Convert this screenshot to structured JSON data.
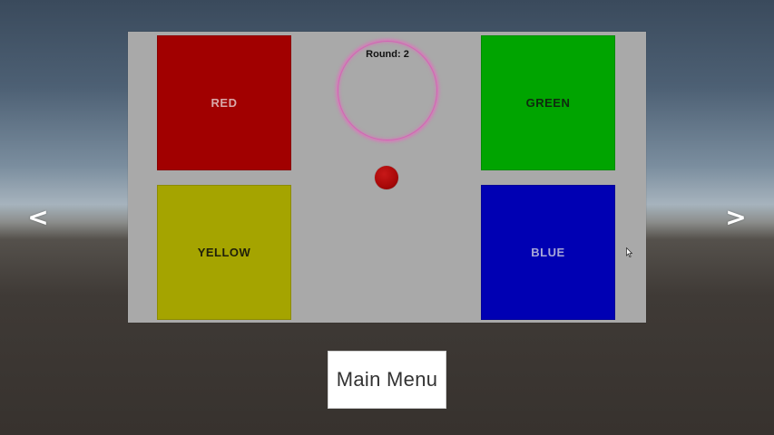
{
  "navigation": {
    "prev_label": "<",
    "next_label": ">"
  },
  "board": {
    "round_text": "Round: 2",
    "pads": {
      "red": {
        "label": "RED",
        "color": "#a10000"
      },
      "green": {
        "label": "GREEN",
        "color": "#00a400"
      },
      "yellow": {
        "label": "YELLOW",
        "color": "#a5a400"
      },
      "blue": {
        "label": "BLUE",
        "color": "#0000b3"
      }
    },
    "indicator_color": "#a80808",
    "ring_color": "#d463b4"
  },
  "footer": {
    "main_menu_label": "Main Menu"
  },
  "icons": {
    "cursor": "arrow-cursor-icon"
  }
}
